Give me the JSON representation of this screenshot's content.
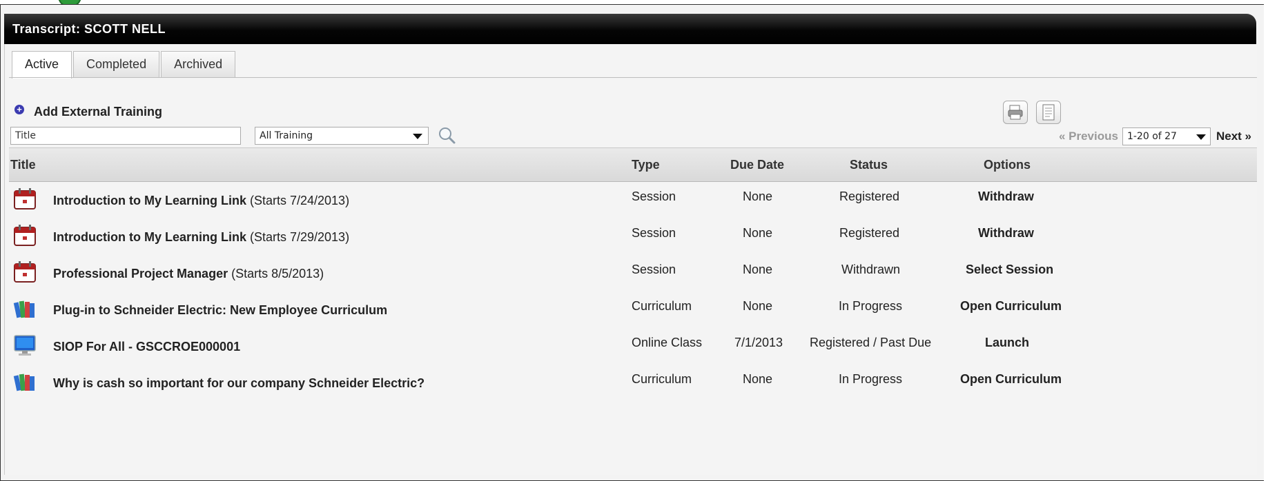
{
  "window": {
    "title": "Transcript: SCOTT NELL"
  },
  "tabs": [
    {
      "label": "Active",
      "active": true
    },
    {
      "label": "Completed",
      "active": false
    },
    {
      "label": "Archived",
      "active": false
    }
  ],
  "actions": {
    "add_external": "Add External Training"
  },
  "filters": {
    "title_value": "Title",
    "type_selected": "All Training"
  },
  "pager": {
    "previous": "« Previous",
    "range": "1-20 of 27",
    "next": "Next »"
  },
  "table": {
    "headers": {
      "title": "Title",
      "type": "Type",
      "due": "Due Date",
      "status": "Status",
      "options": "Options"
    },
    "rows": [
      {
        "icon": "calendar-icon",
        "title_bold": "Introduction to My Learning Link",
        "title_rest": " (Starts 7/24/2013)",
        "type": "Session",
        "due": "None",
        "status": "Registered",
        "option": "Withdraw"
      },
      {
        "icon": "calendar-icon",
        "title_bold": "Introduction to My Learning Link",
        "title_rest": " (Starts 7/29/2013)",
        "type": "Session",
        "due": "None",
        "status": "Registered",
        "option": "Withdraw"
      },
      {
        "icon": "calendar-icon",
        "title_bold": "Professional Project Manager",
        "title_rest": " (Starts 8/5/2013)",
        "type": "Session",
        "due": "None",
        "status": "Withdrawn",
        "option": "Select Session"
      },
      {
        "icon": "books-icon",
        "title_bold": "Plug-in to Schneider Electric: New Employee Curriculum",
        "title_rest": "",
        "type": "Curriculum",
        "due": "None",
        "status": "In Progress",
        "option": "Open Curriculum"
      },
      {
        "icon": "monitor-icon",
        "title_bold": "SIOP For All - GSCCROE000001",
        "title_rest": "",
        "type": "Online Class",
        "due": "7/1/2013",
        "status": "Registered / Past Due",
        "option": "Launch"
      },
      {
        "icon": "books-icon",
        "title_bold": "Why is cash so important for our company Schneider Electric?",
        "title_rest": "",
        "type": "Curriculum",
        "due": "None",
        "status": "In Progress",
        "option": "Open Curriculum"
      }
    ]
  },
  "icons": {
    "add": "plus-circle-icon",
    "print": "printer-icon",
    "export": "document-icon",
    "search": "magnifier-icon"
  },
  "colors": {
    "titlebar": "#000000",
    "accent_plus": "#3b3bb0",
    "badge": "#2e9b3a"
  }
}
